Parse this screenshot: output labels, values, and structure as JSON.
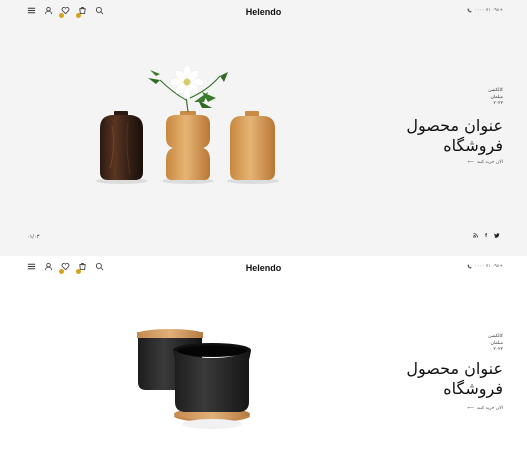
{
  "header": {
    "logo": "Helendo",
    "phone": "۰۰۰۰ ۷۱ ۰۹۸+"
  },
  "icons": {
    "menu": "menu-icon",
    "user": "user-icon",
    "wishlist": "heart-icon",
    "cart": "cart-icon",
    "search": "search-icon",
    "phone": "phone-icon"
  },
  "slides": [
    {
      "subtitle_lines": [
        "کالکشن",
        "مبلمان",
        "۲۰۲۲"
      ],
      "title_lines": [
        "عنوان محصول",
        "فروشگاه"
      ],
      "cta": "الان خرید کنید",
      "slide_counter": "۰۱/۰۳"
    },
    {
      "subtitle_lines": [
        "کالکشن",
        "مبلمان",
        "۲۰۲۲"
      ],
      "title_lines": [
        "عنوان محصول",
        "فروشگاه"
      ],
      "cta": "الان خرید کنید"
    }
  ],
  "social": [
    "twitter-icon",
    "facebook-icon",
    "rss-icon"
  ],
  "colors": {
    "accent": "#d9a21b",
    "hero_bg": "#f4f4f4"
  }
}
